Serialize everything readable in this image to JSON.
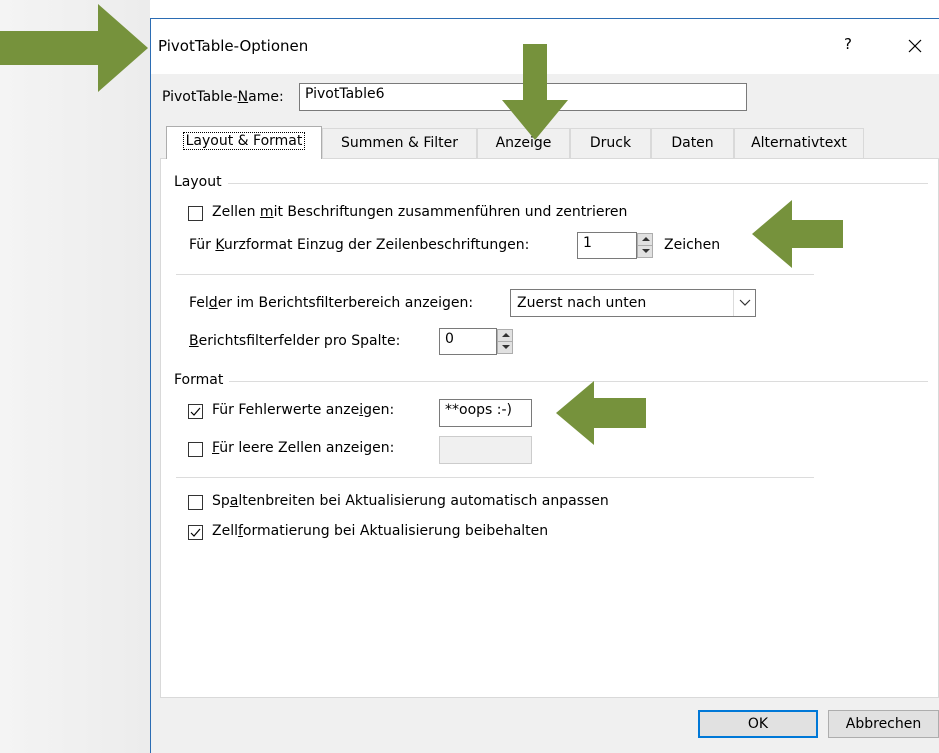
{
  "dialog": {
    "title": "PivotTable-Optionen",
    "help": "?",
    "name_label_pre": "PivotTable-",
    "name_label_u": "N",
    "name_label_post": "ame:",
    "name_value": "PivotTable6"
  },
  "tabs": [
    {
      "label": "Layout & Format",
      "active": true
    },
    {
      "label": "Summen & Filter"
    },
    {
      "label": "Anzeige"
    },
    {
      "label": "Druck"
    },
    {
      "label": "Daten"
    },
    {
      "label": "Alternativtext"
    }
  ],
  "layout_group": {
    "title": "Layout",
    "merge_pre": "Zellen ",
    "merge_u": "m",
    "merge_post": "it Beschriftungen zusammenführen und zentrieren",
    "merge_checked": false,
    "indent_pre": "Für ",
    "indent_u": "K",
    "indent_post": "urzformat Einzug der Zeilenbeschriftungen:",
    "indent_value": "1",
    "indent_unit": "Zeichen",
    "filter_area_pre": "Fel",
    "filter_area_u": "d",
    "filter_area_post": "er im Berichtsfilterbereich anzeigen:",
    "filter_area_value": "Zuerst nach unten",
    "filter_per_col_u": "B",
    "filter_per_col_post": "erichtsfilterfelder pro Spalte:",
    "filter_per_col_value": "0"
  },
  "format_group": {
    "title": "Format",
    "error_pre": "Für Fehlerwerte anze",
    "error_u": "i",
    "error_post": "gen:",
    "error_checked": true,
    "error_value": "**oops :-)",
    "empty_u": "F",
    "empty_post": "ür leere Zellen anzeigen:",
    "empty_checked": false,
    "empty_value": "",
    "autofit_pre": "Sp",
    "autofit_u": "a",
    "autofit_post": "ltenbreiten bei Aktualisierung automatisch anpassen",
    "autofit_checked": false,
    "preserve_pre": "Zell",
    "preserve_u": "f",
    "preserve_post": "ormatierung bei Aktualisierung beibehalten",
    "preserve_checked": true
  },
  "buttons": {
    "ok": "OK",
    "cancel": "Abbrechen"
  },
  "colors": {
    "arrow": "#76923c",
    "dialog_border": "#2b6cb3",
    "default_button": "#0078d7"
  },
  "icons": [
    "close-icon",
    "checkmark-icon",
    "spin-up-icon",
    "spin-down-icon",
    "chevron-down-icon",
    "annotation-arrow-right",
    "annotation-arrow-down",
    "annotation-arrow-left"
  ]
}
